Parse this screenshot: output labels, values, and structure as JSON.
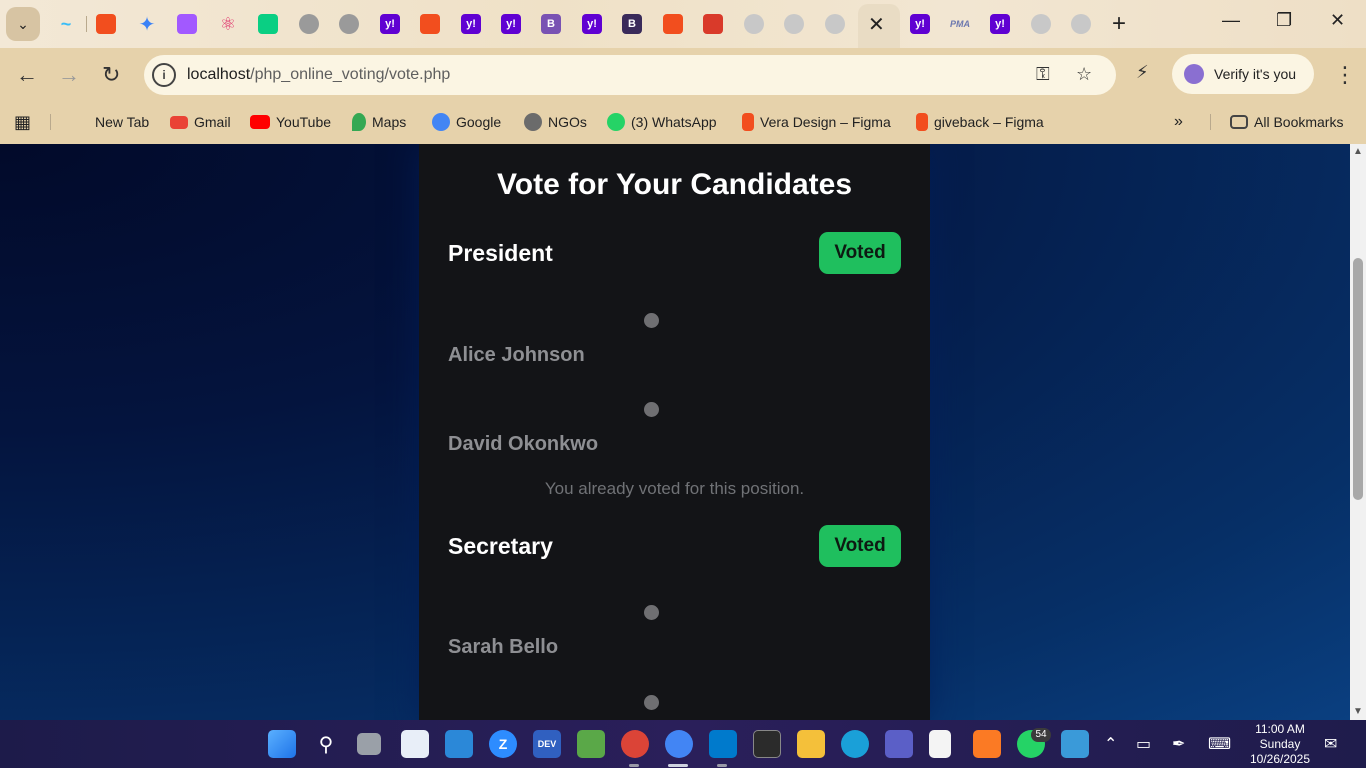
{
  "browser": {
    "url_host": "localhost",
    "url_path": "/php_online_voting/vote.php",
    "profile_label": "Verify it's you",
    "window_controls": [
      "minimize-icon",
      "restore-icon",
      "close-icon"
    ]
  },
  "tabs": {
    "icons": [
      "tailwind-icon",
      "figma-icon",
      "gemini-icon",
      "figma-icon",
      "react-icon",
      "figma-icon",
      "globe-icon",
      "globe-icon",
      "yahoo-icon",
      "figma-icon",
      "yahoo-icon",
      "yahoo-icon",
      "bootstrap-icon",
      "yahoo-icon",
      "bootstrap-icon",
      "figma-icon",
      "shield-icon",
      "github-icon",
      "github-icon",
      "github-icon",
      "close-icon",
      "yahoo-icon",
      "phpmyadmin-icon",
      "yahoo-icon",
      "github-icon",
      "github-icon"
    ],
    "colors": {
      "figma": "#f24e1e",
      "yahoo": "#6001d2",
      "bootstrap": "#7952b3",
      "github": "#c8c8c8"
    }
  },
  "bookmarks": {
    "items": [
      {
        "label": "New Tab",
        "icon": "none"
      },
      {
        "label": "Gmail",
        "icon": "gmail-icon"
      },
      {
        "label": "YouTube",
        "icon": "youtube-icon"
      },
      {
        "label": "Maps",
        "icon": "maps-icon"
      },
      {
        "label": "Google",
        "icon": "google-icon"
      },
      {
        "label": "NGOs",
        "icon": "heart-icon"
      },
      {
        "label": "(3) WhatsApp",
        "icon": "whatsapp-icon"
      },
      {
        "label": "Vera Design – Figma",
        "icon": "figma-icon"
      },
      {
        "label": "giveback – Figma",
        "icon": "figma-icon"
      }
    ],
    "all_bookmarks": "All Bookmarks"
  },
  "voting": {
    "title": "Vote for Your Candidates",
    "positions": [
      {
        "name": "President",
        "status": "Voted",
        "candidates": [
          "Alice Johnson",
          "David Okonkwo"
        ],
        "notice": "You already voted for this position."
      },
      {
        "name": "Secretary",
        "status": "Voted",
        "candidates": [
          "Sarah Bello"
        ]
      }
    ],
    "accent": "#1fbf5e"
  },
  "taskbar": {
    "apps": [
      "windows-start-icon",
      "search-icon",
      "task-view-icon",
      "widgets-icon",
      "store-icon",
      "zoom-icon",
      "devhome-icon",
      "notepad-icon",
      "chrome-icon",
      "chrome-icon",
      "vscode-icon",
      "terminal-icon",
      "file-explorer-icon",
      "edge-icon",
      "teams-icon",
      "file-icon",
      "xampp-icon",
      "whatsapp-icon",
      "notepad-icon"
    ],
    "whatsapp_badge": "54",
    "time": "11:00 AM",
    "day": "Sunday",
    "date": "10/26/2025"
  }
}
